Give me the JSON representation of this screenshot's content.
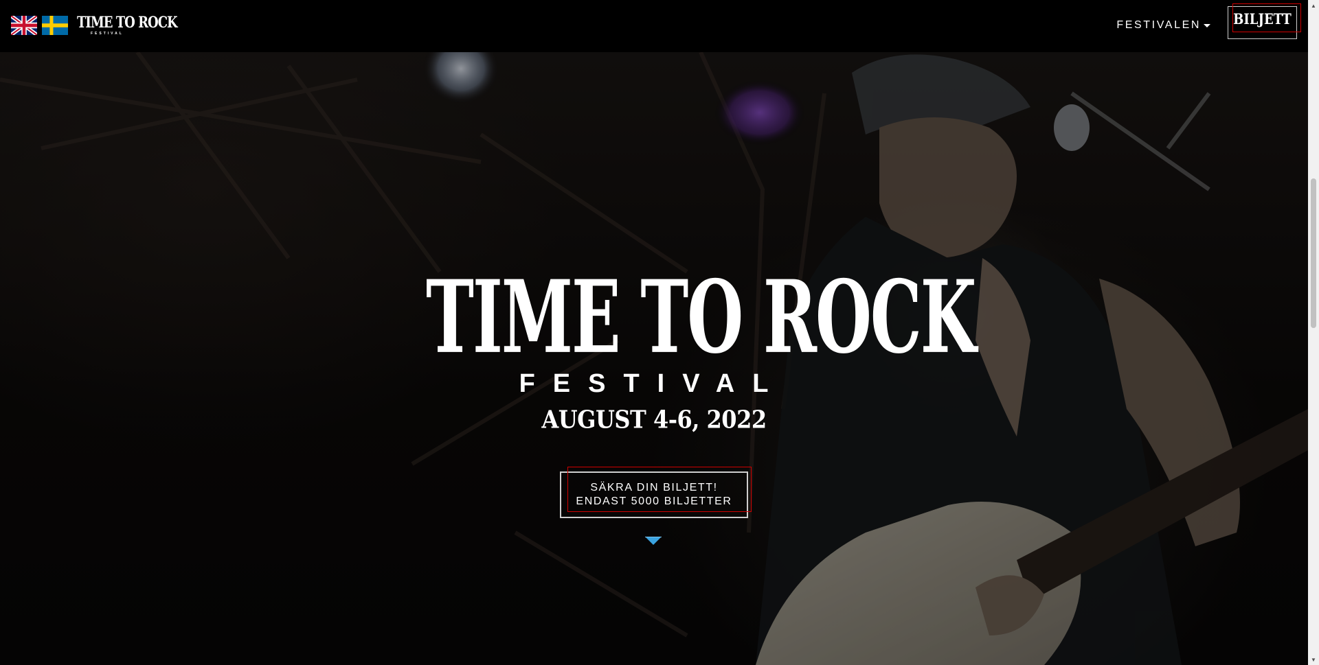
{
  "header": {
    "languages": [
      {
        "code": "en",
        "icon": "uk-flag-icon"
      },
      {
        "code": "sv",
        "icon": "sweden-flag-icon"
      }
    ],
    "logo": {
      "main": "TIME TO ROCK",
      "sub": "FESTIVAL"
    },
    "nav": {
      "festivalen": "FESTIVALEN"
    },
    "ticket_button": "BILJETT"
  },
  "hero": {
    "title": "TIME TO ROCK",
    "subtitle": "FESTIVAL",
    "date": "AUGUST 4-6, 2022",
    "cta_line1": "SÄKRA DIN BILJETT!",
    "cta_line2": "ENDAST 5000 BILJETTER",
    "scroll_icon": "chevron-down-icon"
  },
  "colors": {
    "background": "#000000",
    "text": "#ffffff",
    "scroll_arrow": "#3aa3e0",
    "highlight_outline": "#d00000"
  }
}
